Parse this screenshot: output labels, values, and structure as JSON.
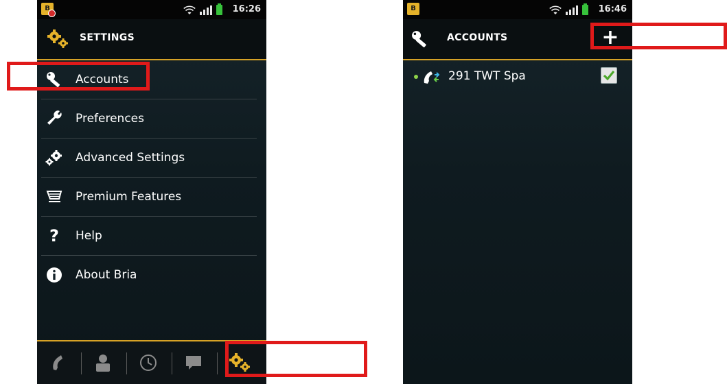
{
  "left_screen": {
    "status": {
      "time": "16:26"
    },
    "header": {
      "title": "SETTINGS"
    },
    "menu": [
      {
        "label": "Accounts",
        "icon": "wrench-key-icon"
      },
      {
        "label": "Preferences",
        "icon": "wrench-icon"
      },
      {
        "label": "Advanced Settings",
        "icon": "gears-icon"
      },
      {
        "label": "Premium Features",
        "icon": "cart-icon"
      },
      {
        "label": "Help",
        "icon": "question-icon"
      },
      {
        "label": "About Bria",
        "icon": "info-icon"
      }
    ],
    "bottom_tabs": [
      {
        "name": "phone",
        "icon": "phone-icon"
      },
      {
        "name": "contacts",
        "icon": "contact-icon"
      },
      {
        "name": "history",
        "icon": "clock-icon"
      },
      {
        "name": "messages",
        "icon": "chat-icon"
      },
      {
        "name": "settings",
        "icon": "settings-gears-icon"
      }
    ]
  },
  "right_screen": {
    "status": {
      "time": "16:46"
    },
    "header": {
      "title": "ACCOUNTS",
      "add_label": "+"
    },
    "accounts": [
      {
        "label": "291 TWT Spa",
        "enabled": true
      }
    ]
  },
  "colors": {
    "accent": "#d7a226",
    "highlight": "#e01a1a",
    "background": "#0f1b20",
    "check": "#4ca82a"
  }
}
